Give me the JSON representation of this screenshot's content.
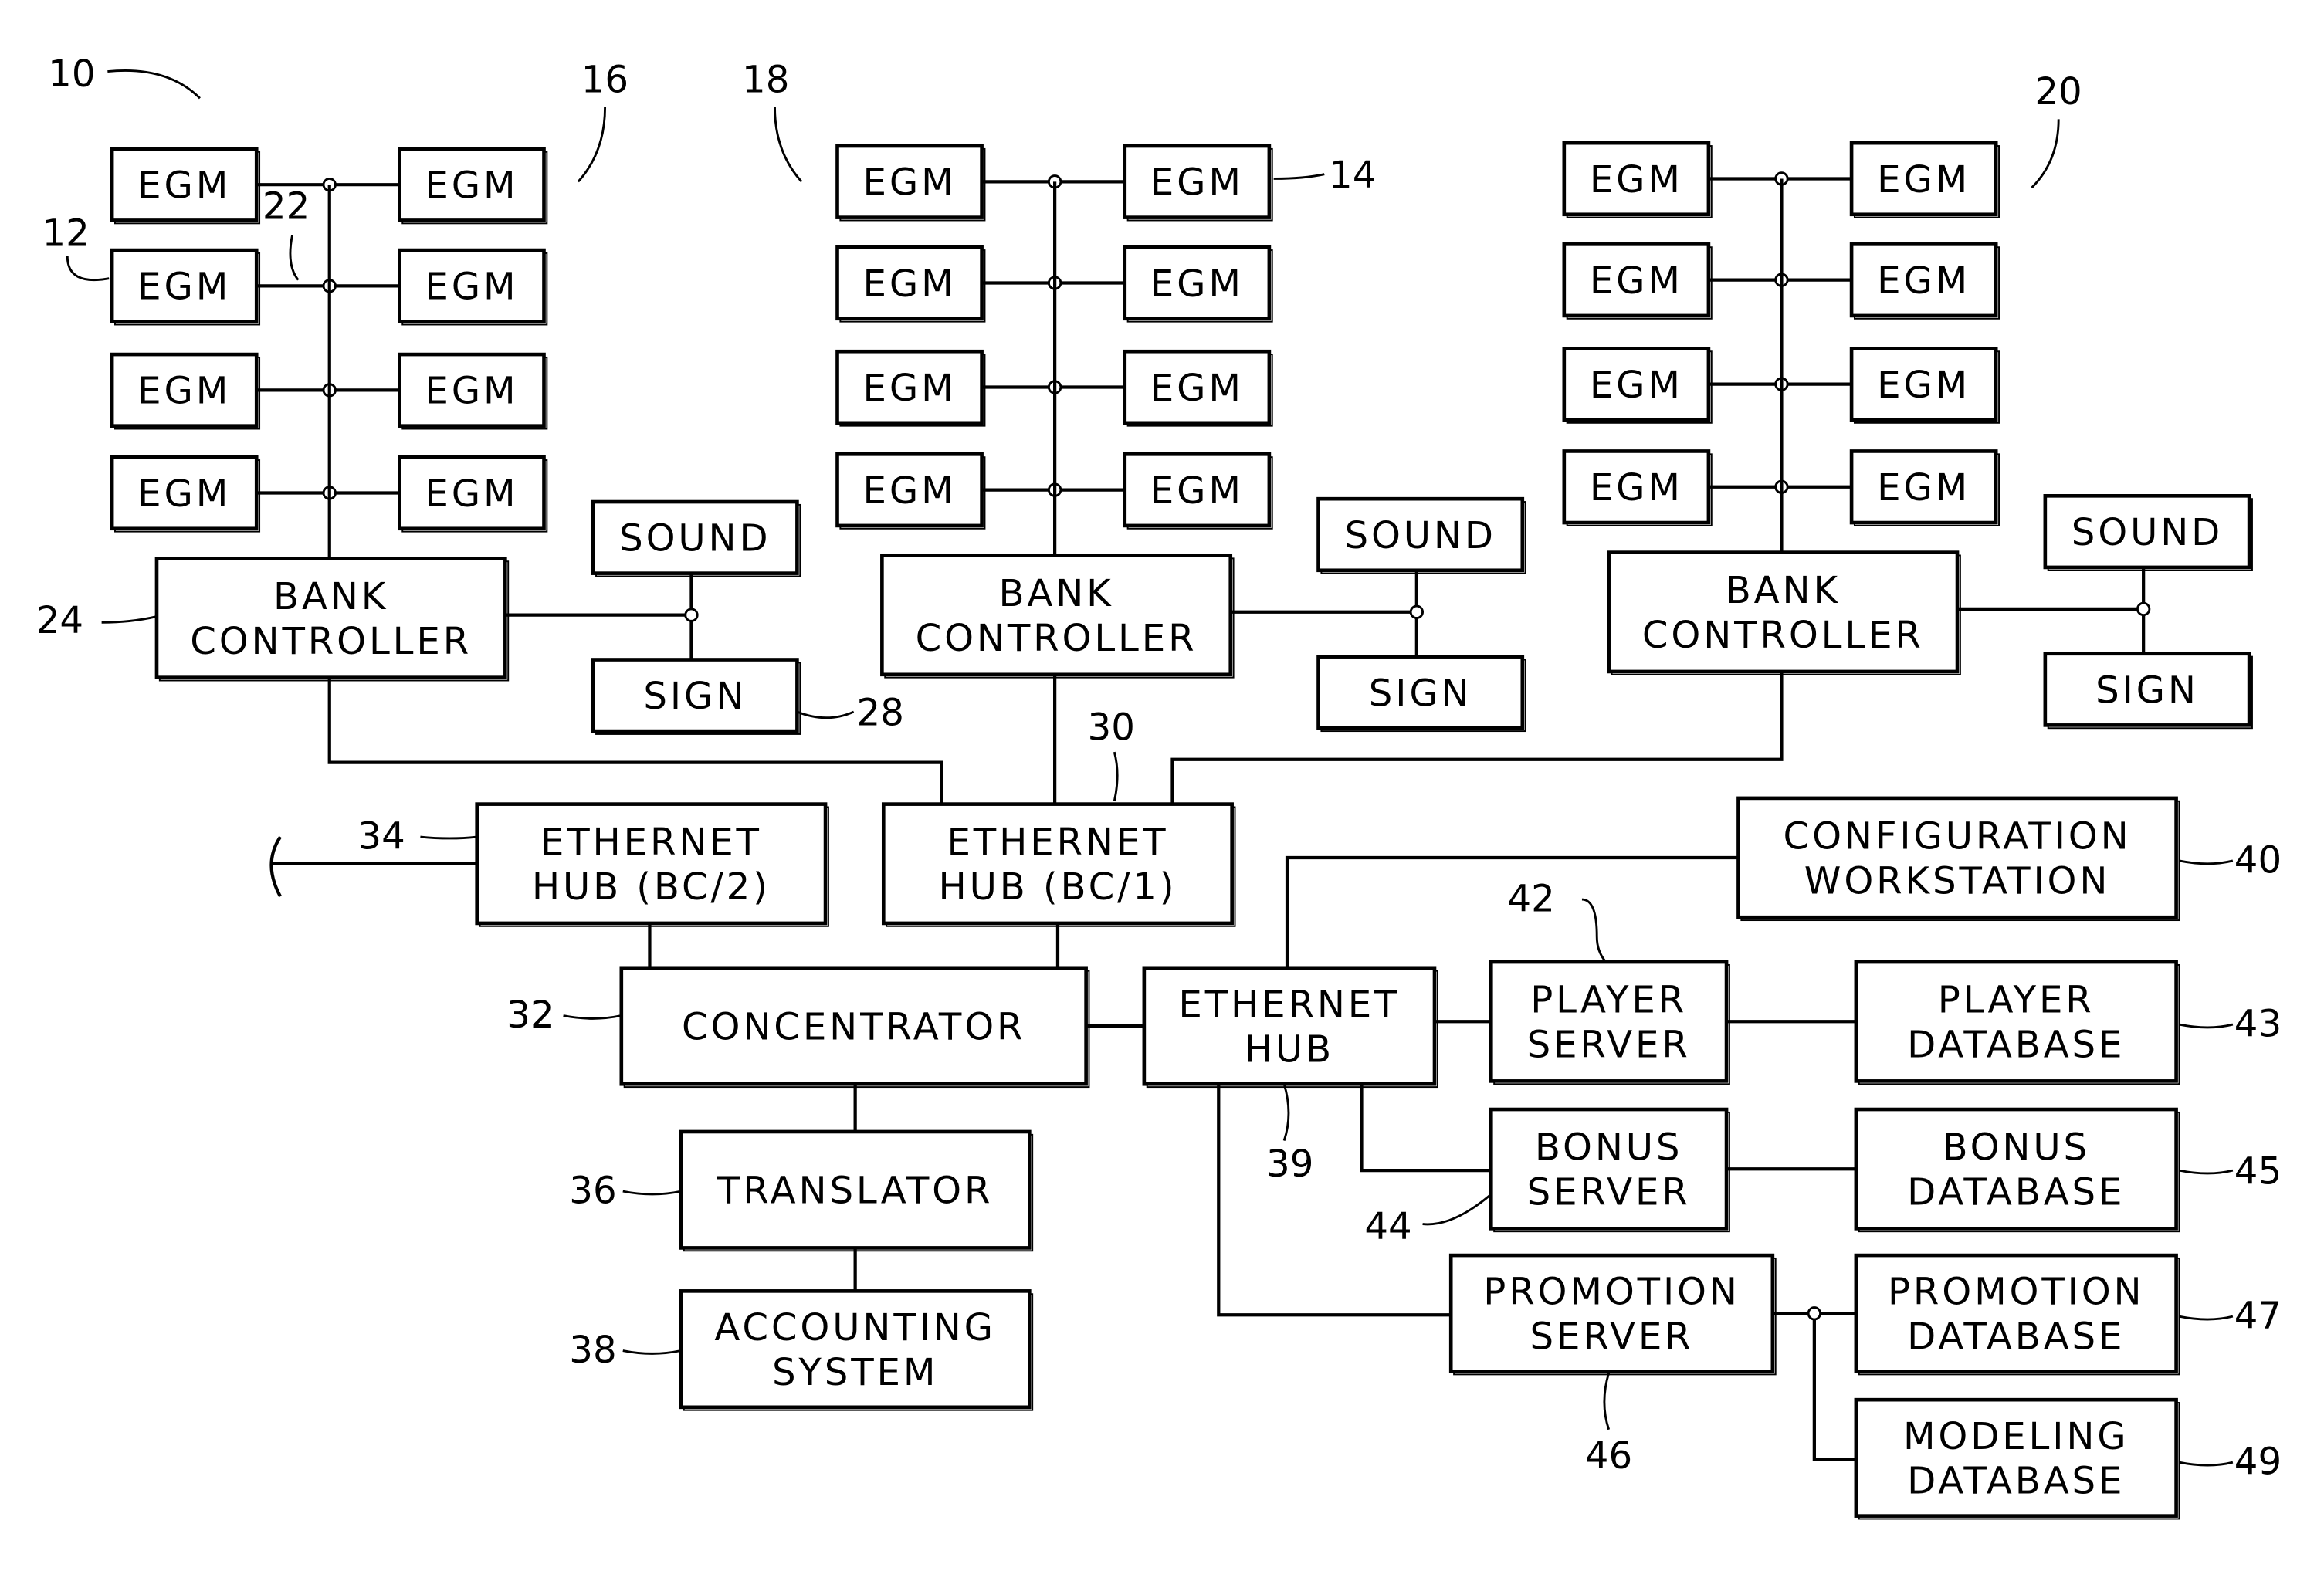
{
  "figure": {
    "overall_ref": "10",
    "banks": [
      {
        "ref": "16",
        "egm_label": "EGM",
        "controller": [
          "BANK",
          "CONTROLLER"
        ],
        "sound": "SOUND",
        "sign": "SIGN"
      },
      {
        "ref": "18",
        "egm_label": "EGM",
        "controller": [
          "BANK",
          "CONTROLLER"
        ],
        "sound": "SOUND",
        "sign": "SIGN"
      },
      {
        "ref": "20",
        "egm_label": "EGM",
        "controller": [
          "BANK",
          "CONTROLLER"
        ],
        "sound": "SOUND",
        "sign": "SIGN"
      }
    ],
    "refs": {
      "egm": "12",
      "egm_b": "14",
      "bus": "22",
      "bank_controller": "24",
      "sign": "28",
      "hub_bc1": "30",
      "concentrator": "32",
      "hub_bc2": "34",
      "translator": "36",
      "accounting": "38",
      "ethernet_hub": "39",
      "config": "40",
      "player_server": "42",
      "player_db": "43",
      "bonus_server": "44",
      "bonus_db": "45",
      "promo_server": "46",
      "promo_db": "47",
      "modeling_db": "49"
    },
    "nodes": {
      "hub_bc2": [
        "ETHERNET",
        "HUB (BC/2)"
      ],
      "hub_bc1": [
        "ETHERNET",
        "HUB (BC/1)"
      ],
      "concentrator": [
        "CONCENTRATOR"
      ],
      "translator": [
        "TRANSLATOR"
      ],
      "accounting": [
        "ACCOUNTING",
        "SYSTEM"
      ],
      "ethernet_hub": [
        "ETHERNET",
        "HUB"
      ],
      "config": [
        "CONFIGURATION",
        "WORKSTATION"
      ],
      "player_server": [
        "PLAYER",
        "SERVER"
      ],
      "player_db": [
        "PLAYER",
        "DATABASE"
      ],
      "bonus_server": [
        "BONUS",
        "SERVER"
      ],
      "bonus_db": [
        "BONUS",
        "DATABASE"
      ],
      "promo_server": [
        "PROMOTION",
        "SERVER"
      ],
      "promo_db": [
        "PROMOTION",
        "DATABASE"
      ],
      "modeling_db": [
        "MODELING",
        "DATABASE"
      ]
    }
  }
}
